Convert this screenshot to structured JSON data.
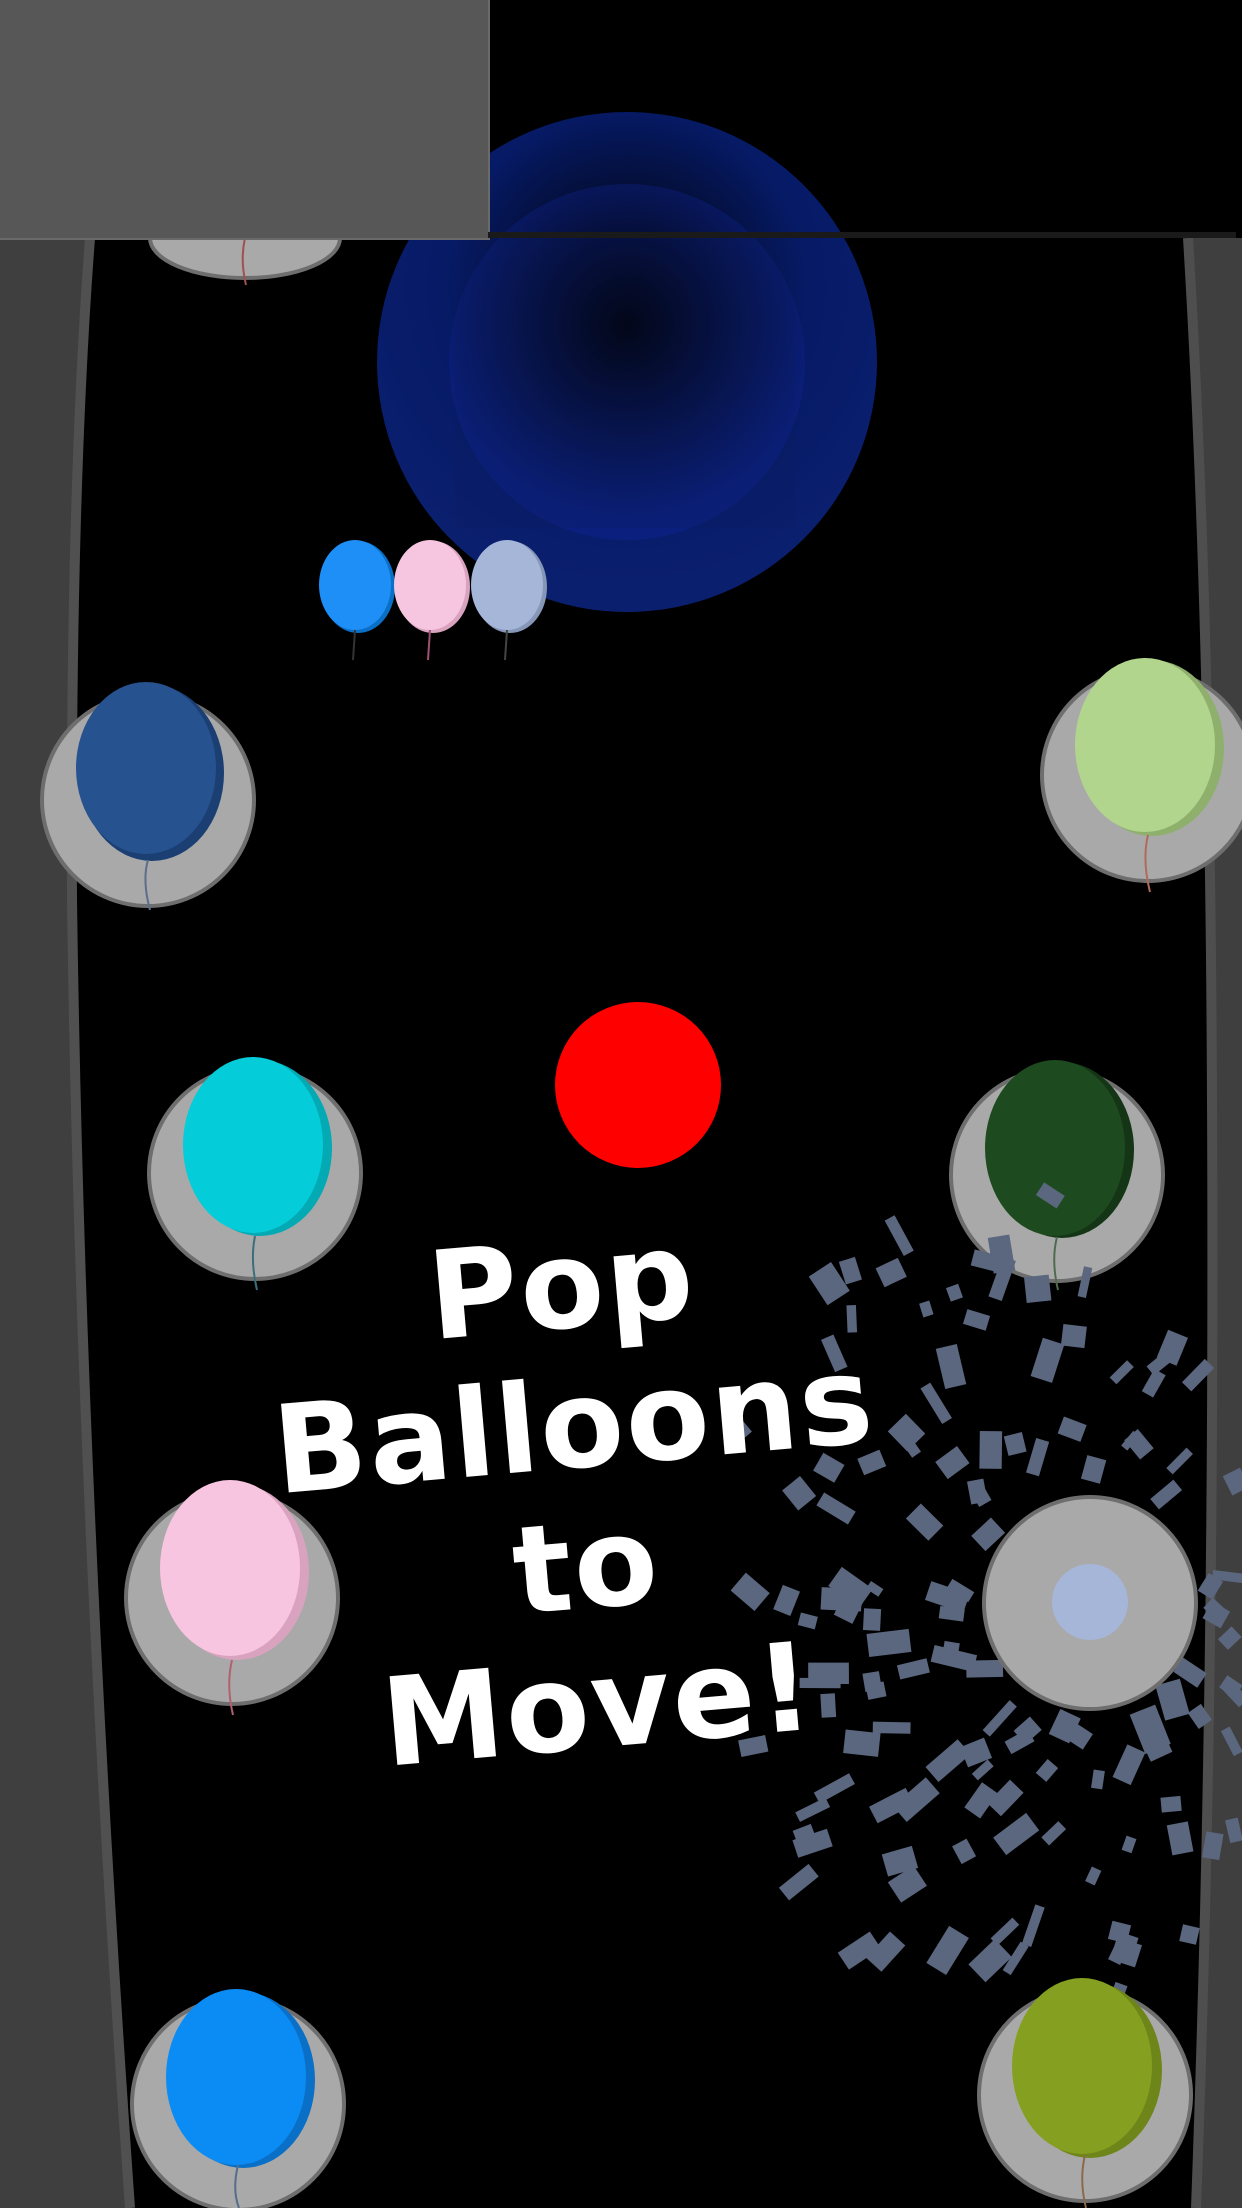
{
  "hud": {
    "queued_balloons": [
      {
        "color": "#1e8ff7"
      },
      {
        "color": "#f6c6e0"
      },
      {
        "color": "#a6b6d8"
      }
    ]
  },
  "instruction": {
    "line1": "Pop Balloons",
    "line2": "to",
    "line3": "Move!"
  },
  "player_ball": {
    "color": "#ff0000"
  },
  "portal": {
    "color": "#0a1f6e"
  },
  "walls": {
    "color": "#3f3f3f"
  },
  "stations": [
    {
      "id": "top-left",
      "balloon": null
    },
    {
      "id": "left-1",
      "balloon": "#26528f"
    },
    {
      "id": "right-1",
      "balloon": "#b1d58d"
    },
    {
      "id": "left-2",
      "balloon": "#04ccd8"
    },
    {
      "id": "right-2",
      "balloon": "#1e4a1f"
    },
    {
      "id": "left-3",
      "balloon": "#f8c5e0"
    },
    {
      "id": "right-3-popped",
      "balloon": "#a6b6d8"
    },
    {
      "id": "left-4",
      "balloon": "#0b8cf5"
    },
    {
      "id": "right-4",
      "balloon": "#85a020"
    }
  ],
  "confetti_color": "#5b677f"
}
